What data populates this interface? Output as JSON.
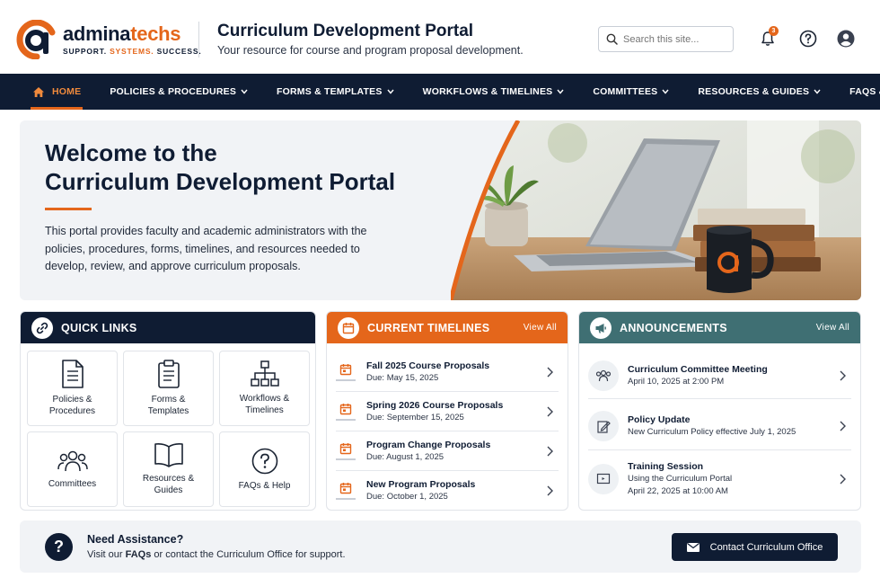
{
  "brand": {
    "name_part1": "admina",
    "name_part2": "techs",
    "tagline_part1": "SUPPORT. ",
    "tagline_part2": "SYSTEMS.",
    "tagline_part3": " SUCCESS.",
    "accent_color": "#e4661b",
    "navy_color": "#0f1c33"
  },
  "header": {
    "title": "Curriculum Development Portal",
    "subtitle": "Your resource for course and program proposal development.",
    "search_placeholder": "Search this site...",
    "notification_count": "3",
    "icons": [
      "bell-icon",
      "help-circle-icon",
      "user-account-icon"
    ]
  },
  "nav": {
    "items": [
      {
        "label": "HOME",
        "active": true,
        "icon": "home-icon"
      },
      {
        "label": "POLICIES & PROCEDURES",
        "dropdown": true
      },
      {
        "label": "FORMS & TEMPLATES",
        "dropdown": true
      },
      {
        "label": "WORKFLOWS & TIMELINES",
        "dropdown": true
      },
      {
        "label": "COMMITTEES",
        "dropdown": true
      },
      {
        "label": "RESOURCES & GUIDES",
        "dropdown": true
      },
      {
        "label": "FAQS & HELP",
        "dropdown": false
      }
    ]
  },
  "hero": {
    "title_line1": "Welcome to the",
    "title_line2": "Curriculum Development Portal",
    "text": "This portal provides faculty and academic administrators with the policies, procedures, forms, timelines, and resources needed to develop, review, and approve curriculum proposals."
  },
  "quick_links": {
    "heading": "QUICK LINKS",
    "color": "#0f1c33",
    "tiles": [
      {
        "line1": "Policies &",
        "line2": "Procedures",
        "icon": "document-icon"
      },
      {
        "line1": "Forms &",
        "line2": "Templates",
        "icon": "clipboard-icon"
      },
      {
        "line1": "Workflows &",
        "line2": "Timelines",
        "icon": "org-chart-icon"
      },
      {
        "line1": "Committees",
        "line2": "",
        "icon": "people-icon"
      },
      {
        "line1": "Resources &",
        "line2": "Guides",
        "icon": "book-icon"
      },
      {
        "line1": "FAQs & Help",
        "line2": "",
        "icon": "question-icon"
      }
    ]
  },
  "timelines": {
    "heading": "CURRENT TIMELINES",
    "view_all": "View All",
    "color": "#e4661b",
    "items": [
      {
        "title": "Fall 2025 Course Proposals",
        "due": "Due: May 15, 2025"
      },
      {
        "title": "Spring 2026 Course Proposals",
        "due": "Due: September 15, 2025"
      },
      {
        "title": "Program Change Proposals",
        "due": "Due: August 1, 2025"
      },
      {
        "title": "New Program Proposals",
        "due": "Due: October 1, 2025"
      }
    ]
  },
  "announcements": {
    "heading": "ANNOUNCEMENTS",
    "view_all": "View All",
    "color": "#3f6f73",
    "items": [
      {
        "title": "Curriculum Committee Meeting",
        "line2": "April 10, 2025 at 2:00 PM",
        "line3": "",
        "icon": "people-icon"
      },
      {
        "title": "Policy Update",
        "line2": "New Curriculum Policy effective July 1, 2025",
        "line3": "",
        "icon": "document-edit-icon"
      },
      {
        "title": "Training Session",
        "line2": "Using the Curriculum Portal",
        "line3": "April 22, 2025 at 10:00 AM",
        "icon": "presentation-icon"
      }
    ]
  },
  "help": {
    "title": "Need Assistance?",
    "text_before": "Visit our ",
    "text_link": "FAQs",
    "text_after": " or contact the Curriculum Office for support.",
    "button_label": "Contact Curriculum Office"
  }
}
